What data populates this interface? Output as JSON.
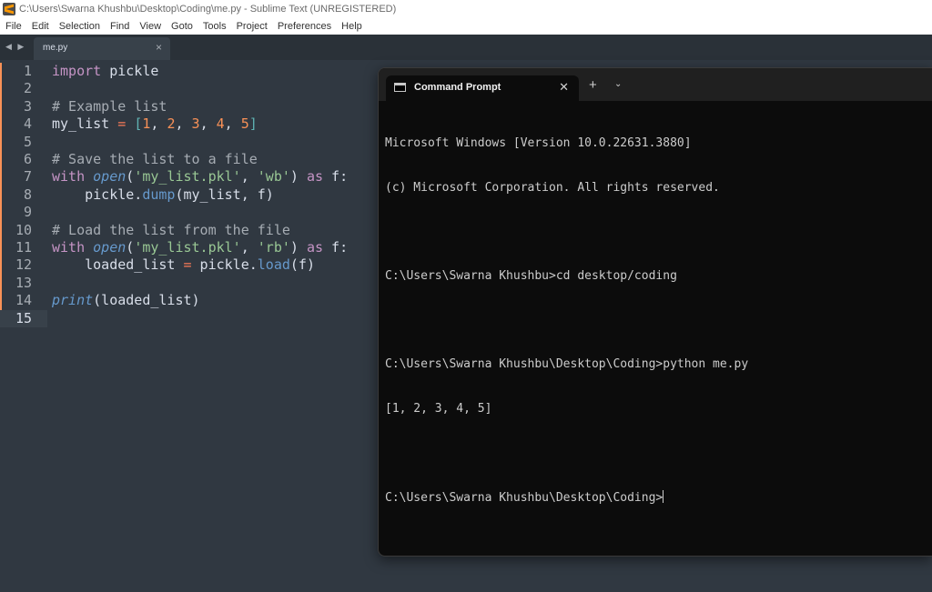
{
  "window": {
    "title": "C:\\Users\\Swarna Khushbu\\Desktop\\Coding\\me.py - Sublime Text (UNREGISTERED)"
  },
  "menu": [
    "File",
    "Edit",
    "Selection",
    "Find",
    "View",
    "Goto",
    "Tools",
    "Project",
    "Preferences",
    "Help"
  ],
  "tab": {
    "nav": "◀ ▶",
    "label": "me.py",
    "close": "×"
  },
  "editor": {
    "current_line": 15,
    "lines": [
      [
        {
          "t": "import",
          "c": "kw"
        },
        {
          "t": " pickle"
        }
      ],
      [],
      [
        {
          "t": "# Example list",
          "c": "cm"
        }
      ],
      [
        {
          "t": "my_list "
        },
        {
          "t": "=",
          "c": "op"
        },
        {
          "t": " "
        },
        {
          "t": "[",
          "c": "br"
        },
        {
          "t": "1",
          "c": "num"
        },
        {
          "t": ", "
        },
        {
          "t": "2",
          "c": "num"
        },
        {
          "t": ", "
        },
        {
          "t": "3",
          "c": "num"
        },
        {
          "t": ", "
        },
        {
          "t": "4",
          "c": "num"
        },
        {
          "t": ", "
        },
        {
          "t": "5",
          "c": "num"
        },
        {
          "t": "]",
          "c": "br"
        }
      ],
      [],
      [
        {
          "t": "# Save the list to a file",
          "c": "cm"
        }
      ],
      [
        {
          "t": "with",
          "c": "kw"
        },
        {
          "t": " "
        },
        {
          "t": "open",
          "c": "fn"
        },
        {
          "t": "("
        },
        {
          "t": "'my_list.pkl'",
          "c": "str"
        },
        {
          "t": ", "
        },
        {
          "t": "'wb'",
          "c": "str"
        },
        {
          "t": ") "
        },
        {
          "t": "as",
          "c": "kw"
        },
        {
          "t": " f:"
        }
      ],
      [
        {
          "t": "    pickle."
        },
        {
          "t": "dump",
          "c": "meth"
        },
        {
          "t": "(my_list, f)"
        }
      ],
      [],
      [
        {
          "t": "# Load the list from the file",
          "c": "cm"
        }
      ],
      [
        {
          "t": "with",
          "c": "kw"
        },
        {
          "t": " "
        },
        {
          "t": "open",
          "c": "fn"
        },
        {
          "t": "("
        },
        {
          "t": "'my_list.pkl'",
          "c": "str"
        },
        {
          "t": ", "
        },
        {
          "t": "'rb'",
          "c": "str"
        },
        {
          "t": ") "
        },
        {
          "t": "as",
          "c": "kw"
        },
        {
          "t": " f:"
        }
      ],
      [
        {
          "t": "    loaded_list "
        },
        {
          "t": "=",
          "c": "op"
        },
        {
          "t": " pickle."
        },
        {
          "t": "load",
          "c": "meth"
        },
        {
          "t": "(f)"
        }
      ],
      [],
      [
        {
          "t": "print",
          "c": "fn"
        },
        {
          "t": "(loaded_list)"
        }
      ],
      []
    ]
  },
  "terminal": {
    "tab_label": "Command Prompt",
    "close": "✕",
    "new_tab": "+",
    "dropdown": "⌄",
    "lines": [
      "Microsoft Windows [Version 10.0.22631.3880]",
      "(c) Microsoft Corporation. All rights reserved.",
      "",
      "C:\\Users\\Swarna Khushbu>cd desktop/coding",
      "",
      "C:\\Users\\Swarna Khushbu\\Desktop\\Coding>python me.py",
      "[1, 2, 3, 4, 5]",
      "",
      "C:\\Users\\Swarna Khushbu\\Desktop\\Coding>"
    ]
  },
  "colors": {
    "editor_bg": "#303841",
    "keyword": "#c594c5",
    "comment": "#a6acb3",
    "string": "#99c794",
    "number": "#f99157",
    "function": "#6699cc",
    "terminal_bg": "#0c0c0c"
  }
}
